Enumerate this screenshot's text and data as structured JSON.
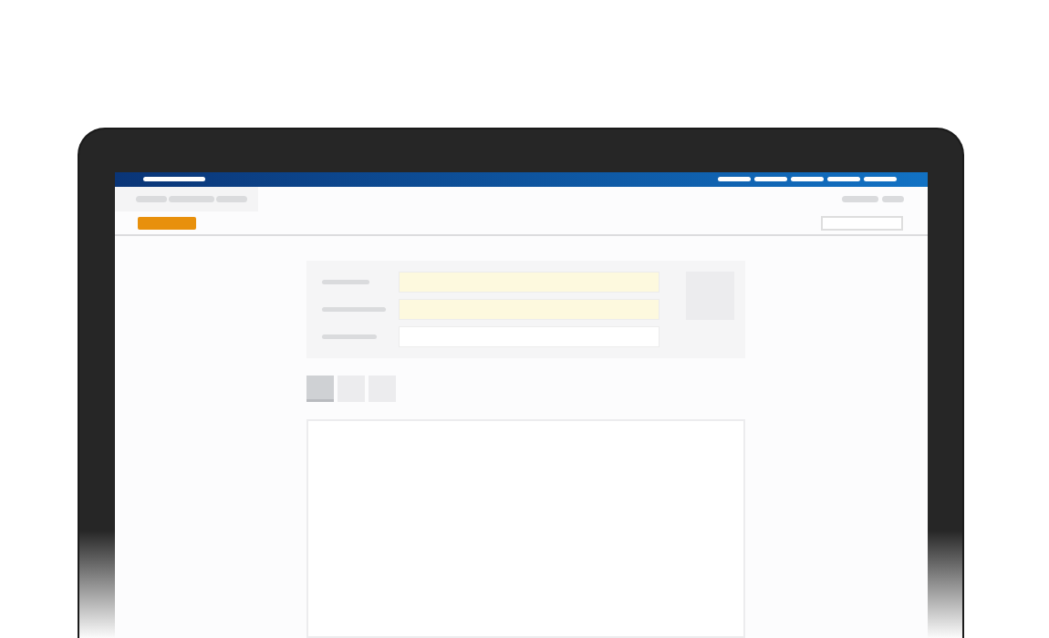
{
  "top_bar": {
    "nav": [
      {
        "kind": "link"
      },
      {
        "kind": "link"
      },
      {
        "kind": "link"
      },
      {
        "kind": "link"
      },
      {
        "kind": "link"
      }
    ]
  },
  "breadcrumbs": [
    {
      "kind": "short"
    },
    {
      "kind": "long"
    },
    {
      "kind": "short"
    }
  ],
  "user_links": [
    {
      "kind": "long"
    },
    {
      "kind": "short"
    }
  ],
  "form": {
    "fields": [
      {
        "highlighted": true
      },
      {
        "highlighted": true
      },
      {
        "highlighted": false
      }
    ]
  },
  "tabs": [
    {
      "selected": true
    },
    {
      "selected": false
    },
    {
      "selected": false
    }
  ]
}
